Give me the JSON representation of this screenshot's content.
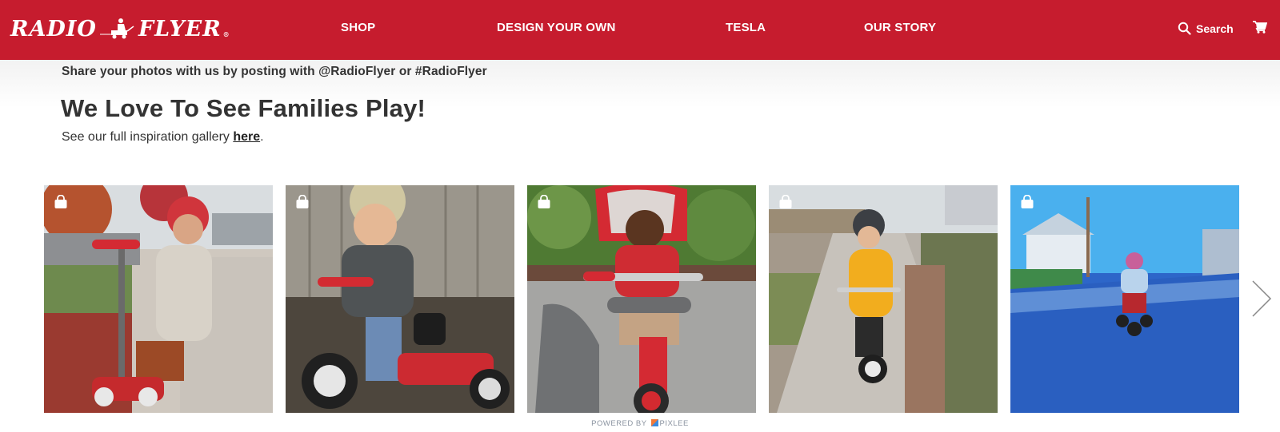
{
  "header": {
    "brand": {
      "left": "RADIO",
      "right": "FLYER",
      "registered": "®",
      "logo_icon": "wagon-rider-icon"
    },
    "nav": [
      {
        "label": "SHOP"
      },
      {
        "label": "DESIGN YOUR OWN"
      },
      {
        "label": "TESLA"
      },
      {
        "label": "OUR STORY"
      }
    ],
    "search_label": "Search",
    "search_icon": "search-icon",
    "cart_icon": "cart-icon",
    "brand_color": "#c61c2e"
  },
  "main": {
    "share_text": "Share your photos with us by posting with @RadioFlyer or #RadioFlyer",
    "title": "We Love To See Families Play!",
    "subtitle_prefix": "See our full inspiration gallery ",
    "subtitle_link": "here",
    "subtitle_suffix": "."
  },
  "gallery": {
    "items": [
      {
        "description": "Toddler in red helmet on red scooter on sidewalk",
        "badge_icon": "shopping-bag-icon"
      },
      {
        "description": "Smiling toddler in helmet on red tricycle by wooden fence",
        "badge_icon": "shopping-bag-icon"
      },
      {
        "description": "Laughing child in red sweater on red stroller trike with canopy",
        "badge_icon": "shopping-bag-icon"
      },
      {
        "description": "Toddler in yellow raincoat on balance bike on sidewalk",
        "badge_icon": "shopping-bag-icon"
      },
      {
        "description": "Child riding red tricycle on blue-tinted street",
        "badge_icon": "shopping-bag-icon"
      }
    ],
    "next_icon": "chevron-right-icon",
    "powered_by_prefix": "POWERED BY",
    "powered_by_brand": "PIXLEE"
  }
}
